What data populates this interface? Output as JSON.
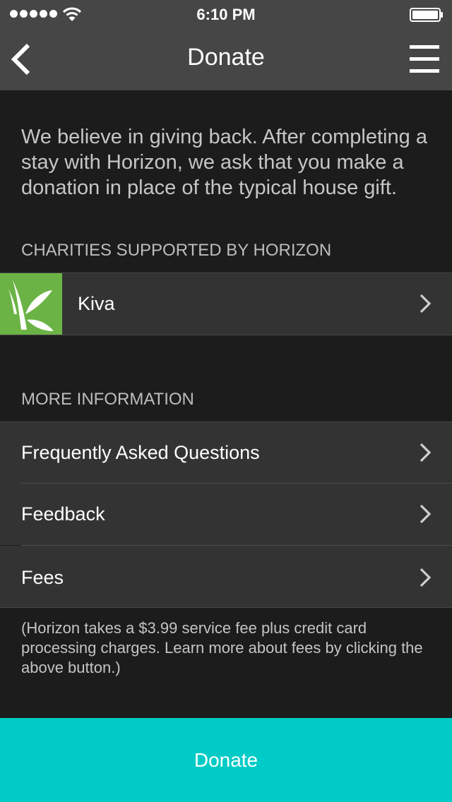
{
  "status_bar": {
    "time": "6:10 PM",
    "signal_icon": "signal-dots-icon",
    "wifi_icon": "wifi-icon",
    "battery_icon": "battery-icon"
  },
  "nav": {
    "title": "Donate",
    "back_icon": "chevron-left-icon",
    "menu_icon": "hamburger-menu-icon"
  },
  "intro_text": "We believe in giving back. After completing a stay with Horizon, we ask that you make a donation in place of the typical house gift.",
  "charities": {
    "header": "CHARITIES SUPPORTED BY HORIZON",
    "items": [
      {
        "label": "Kiva",
        "logo_icon": "kiva-logo-icon"
      }
    ]
  },
  "more_info": {
    "header": "MORE INFORMATION",
    "items": [
      {
        "label": "Frequently Asked Questions"
      },
      {
        "label": "Feedback"
      },
      {
        "label": "Fees"
      }
    ]
  },
  "fee_note": "(Horizon takes a $3.99 service fee plus credit card processing charges. Learn more about fees by clicking the above button.)",
  "donate_button": "Donate",
  "colors": {
    "bar_background": "#464646",
    "page_background": "#1c1c1c",
    "cell_background": "#333333",
    "kiva_green": "#6bb345",
    "accent_teal": "#00cbc6"
  }
}
